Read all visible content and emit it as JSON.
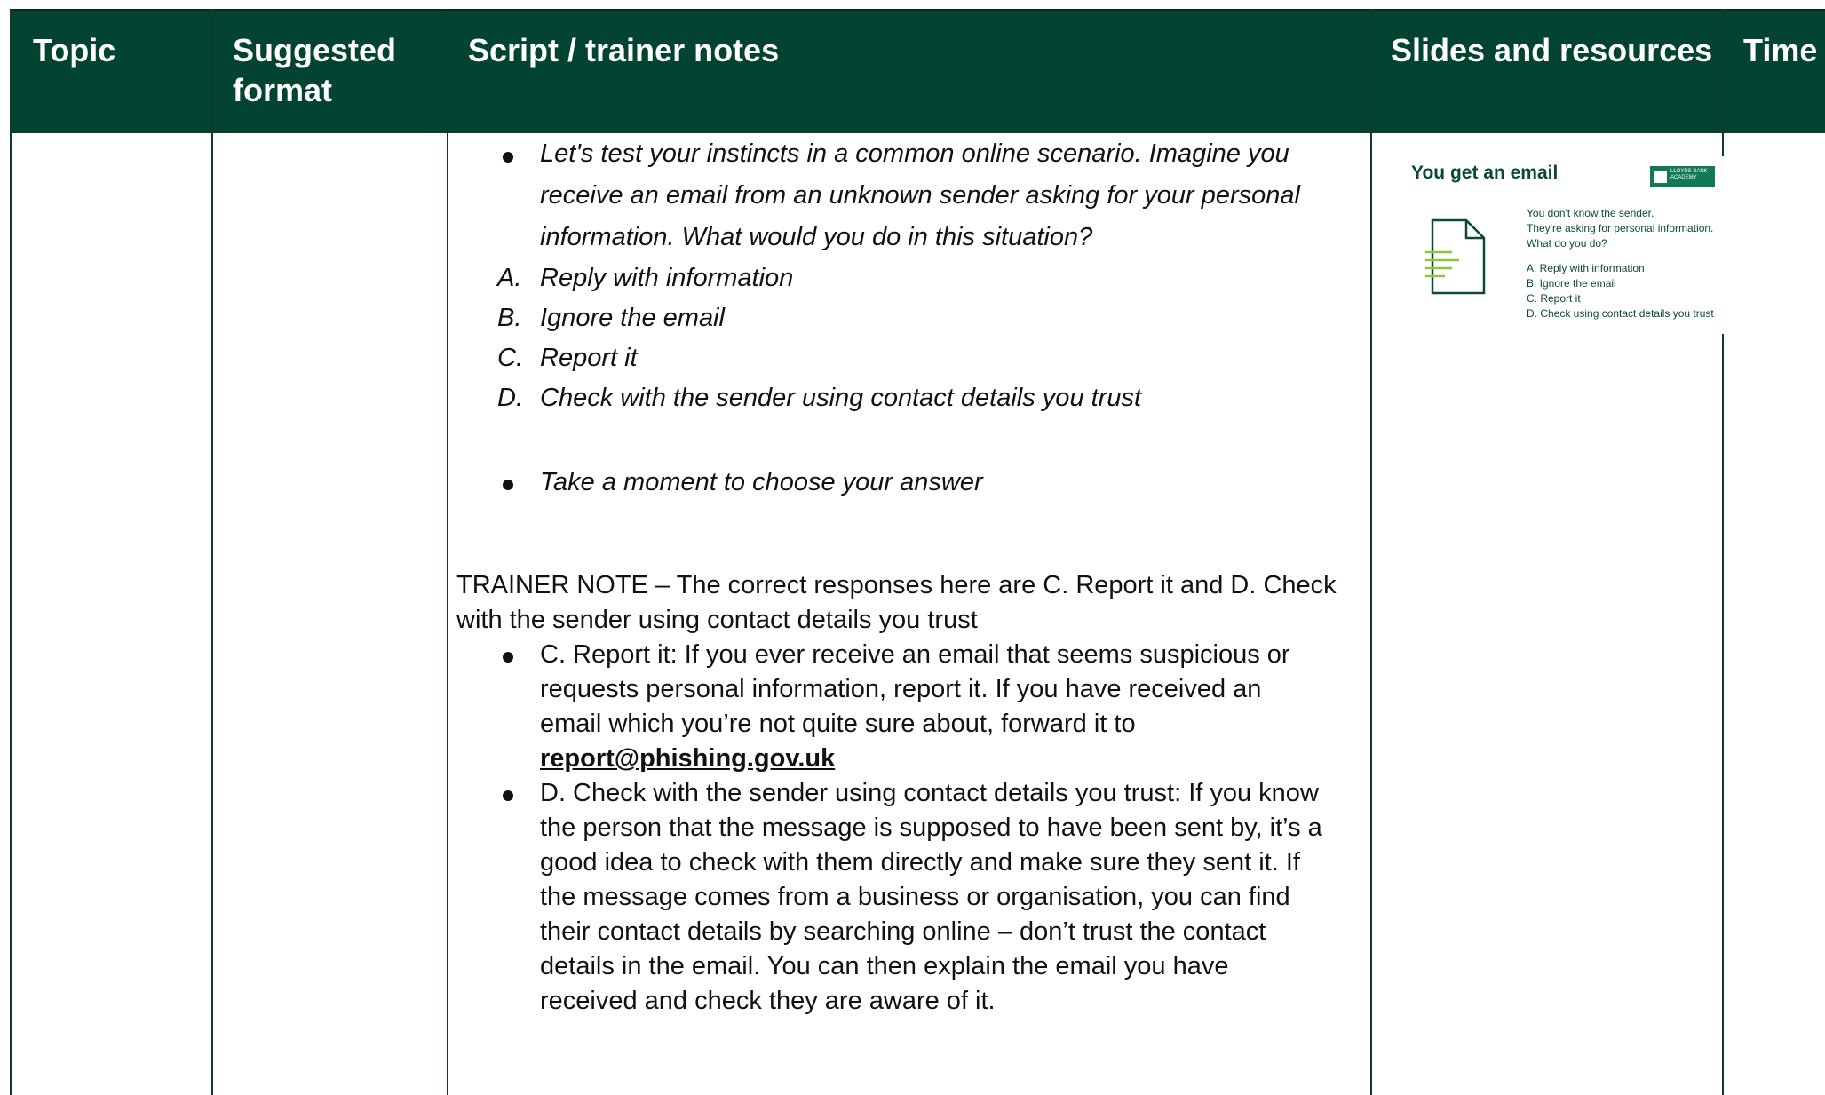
{
  "header": {
    "col_topic": "Topic",
    "col_format_line1": "Suggested",
    "col_format_line2": "format",
    "col_script": "Script / trainer notes",
    "col_slides": "Slides and resources",
    "col_time": "Time"
  },
  "script": {
    "question_lines": [
      "Let's test your instincts in a common online scenario. Imagine you",
      "receive an email from an unknown sender asking for your personal",
      "information. What would you do in this situation?"
    ],
    "options": [
      {
        "letter": "A.",
        "text": "Reply with information"
      },
      {
        "letter": "B.",
        "text": "Ignore the email"
      },
      {
        "letter": "C.",
        "text": "Report it"
      },
      {
        "letter": "D.",
        "text": "Check with the sender using contact details you trust"
      }
    ],
    "prompt": "Take a moment to choose your answer",
    "trainer_note_lines": [
      "TRAINER NOTE – The correct responses here are C. Report it and D. Check",
      "with the sender using contact details you trust"
    ],
    "note_bullet_c_lines": [
      "C. Report it: If you ever receive an email that seems suspicious or",
      "requests personal information, report it. If you have received an",
      "email which you’re not quite sure about, forward it to"
    ],
    "report_link": "report@phishing.gov.uk",
    "note_bullet_d_lines": [
      "D. Check with the sender using contact details you trust: If you know",
      "the person that the message is supposed to have been sent by, it’s a",
      "good idea to check with them directly and make sure they sent it. If",
      "the message comes from a business or organisation, you can find",
      "their contact details by searching online – don’t trust the contact",
      "details in the email. You can then explain the email you have",
      "received and check they are aware of it."
    ]
  },
  "slide": {
    "title": "You get an email",
    "logo_text": "LLOYDS BANK ACADEMY",
    "lines": [
      "You don't know the sender.",
      "They're asking for personal information.",
      "What do you do?"
    ],
    "options": [
      "A.  Reply with information",
      "B.  Ignore the email",
      "C.  Report it",
      "D.  Check using contact details you trust"
    ],
    "icon": "document-icon"
  },
  "colors": {
    "header_bg": "#034332",
    "accent_green": "#117a52",
    "icon_line_green": "#8cc63f"
  }
}
